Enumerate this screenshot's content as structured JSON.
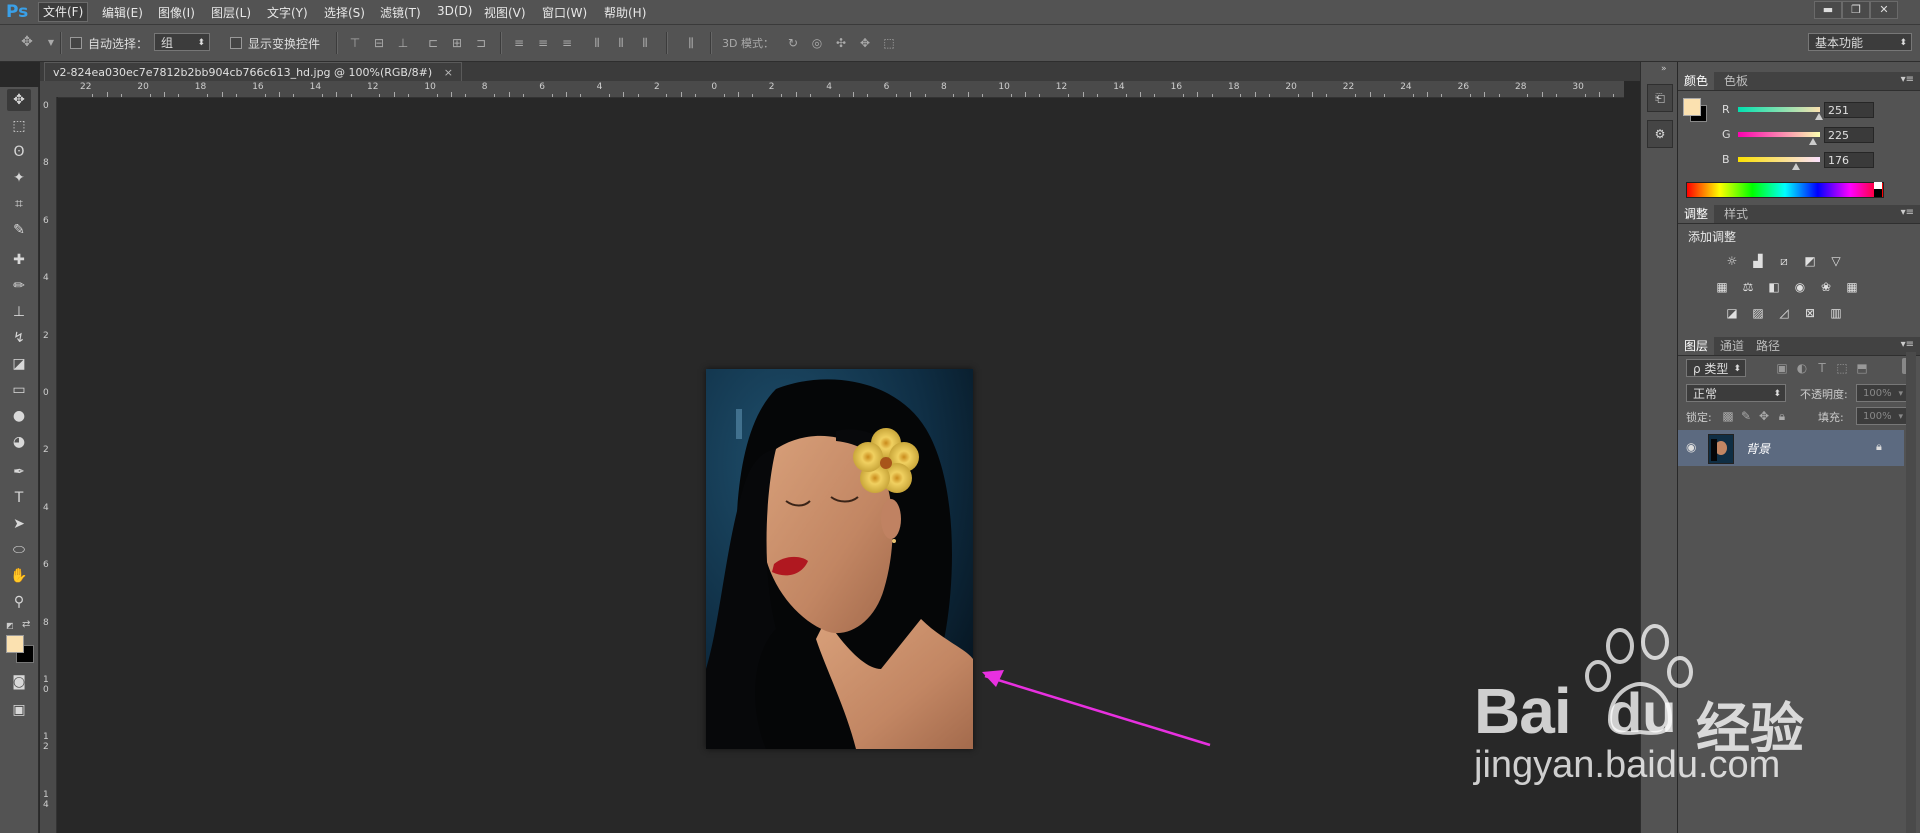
{
  "app": {
    "logo": "Ps"
  },
  "menu": [
    "文件(F)",
    "编辑(E)",
    "图像(I)",
    "图层(L)",
    "文字(Y)",
    "选择(S)",
    "滤镜(T)",
    "3D(D)",
    "视图(V)",
    "窗口(W)",
    "帮助(H)"
  ],
  "window_controls": {
    "minimize": "▬",
    "restore": "❐",
    "close": "✕"
  },
  "options": {
    "auto_select_label": "自动选择：",
    "auto_select_value": "组",
    "show_transform_label": "显示变换控件",
    "mode3d_label": "3D 模式：",
    "workspace_value": "基本功能"
  },
  "document": {
    "tab_title": "v2-824ea030ec7e7812b2bb904cb766c613_hd.jpg @ 100%(RGB/8#)",
    "tab_close": "×"
  },
  "ruler": {
    "h_ticks": [
      "22",
      "20",
      "18",
      "16",
      "14",
      "12",
      "10",
      "8",
      "6",
      "4",
      "2",
      "0",
      "2",
      "4",
      "6",
      "8",
      "10",
      "12",
      "14",
      "16",
      "18",
      "20",
      "22",
      "24",
      "26",
      "28",
      "30",
      "3"
    ],
    "v_ticks": [
      "0",
      "8",
      "6",
      "4",
      "2",
      "0",
      "2",
      "4",
      "6",
      "8",
      "1 0",
      "1 2",
      "1 4"
    ]
  },
  "color_panel": {
    "tabs": [
      "颜色",
      "色板"
    ],
    "channels": [
      {
        "label": "R",
        "value": "251"
      },
      {
        "label": "G",
        "value": "225"
      },
      {
        "label": "B",
        "value": "176"
      }
    ],
    "foreground": "#fbe1b0",
    "background": "#000000"
  },
  "adjust_panel": {
    "tabs": [
      "调整",
      "样式"
    ],
    "title": "添加调整"
  },
  "layers_panel": {
    "tabs": [
      "图层",
      "通道",
      "路径"
    ],
    "filter_label": "ρ 类型",
    "blend_mode": "正常",
    "opacity_label": "不透明度:",
    "opacity_value": "100%",
    "lock_label": "锁定:",
    "fill_label": "填充:",
    "fill_value": "100%",
    "layers": [
      {
        "name": "背景",
        "visible": true,
        "locked": true
      }
    ]
  },
  "watermark": {
    "brand_a": "Bai",
    "brand_b": "du",
    "brand_cn": "经验",
    "url": "jingyan.baidu.com"
  },
  "colors": {
    "accent_arrow": "#e830e0",
    "ps_blue": "#3aa0e8"
  }
}
